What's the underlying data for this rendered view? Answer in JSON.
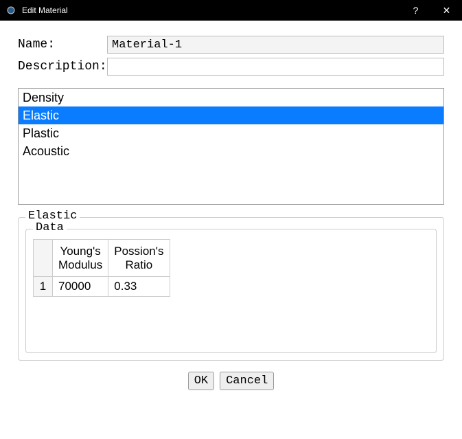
{
  "titlebar": {
    "title": "Edit Material",
    "help": "?",
    "close": "✕"
  },
  "form": {
    "name_label": "Name:",
    "name_value": "Material-1",
    "desc_label": "Description:",
    "desc_value": ""
  },
  "behaviors": {
    "items": [
      "Density",
      "Elastic",
      "Plastic",
      "Acoustic"
    ],
    "selected_index": 1
  },
  "group": {
    "legend": "Elastic",
    "inner_legend": "Data",
    "table": {
      "columns": [
        "Young's Modulus",
        "Possion's Ratio"
      ],
      "rows": [
        {
          "n": "1",
          "cells": [
            "70000",
            "0.33"
          ]
        }
      ]
    }
  },
  "buttons": {
    "ok": "OK",
    "cancel": "Cancel"
  }
}
